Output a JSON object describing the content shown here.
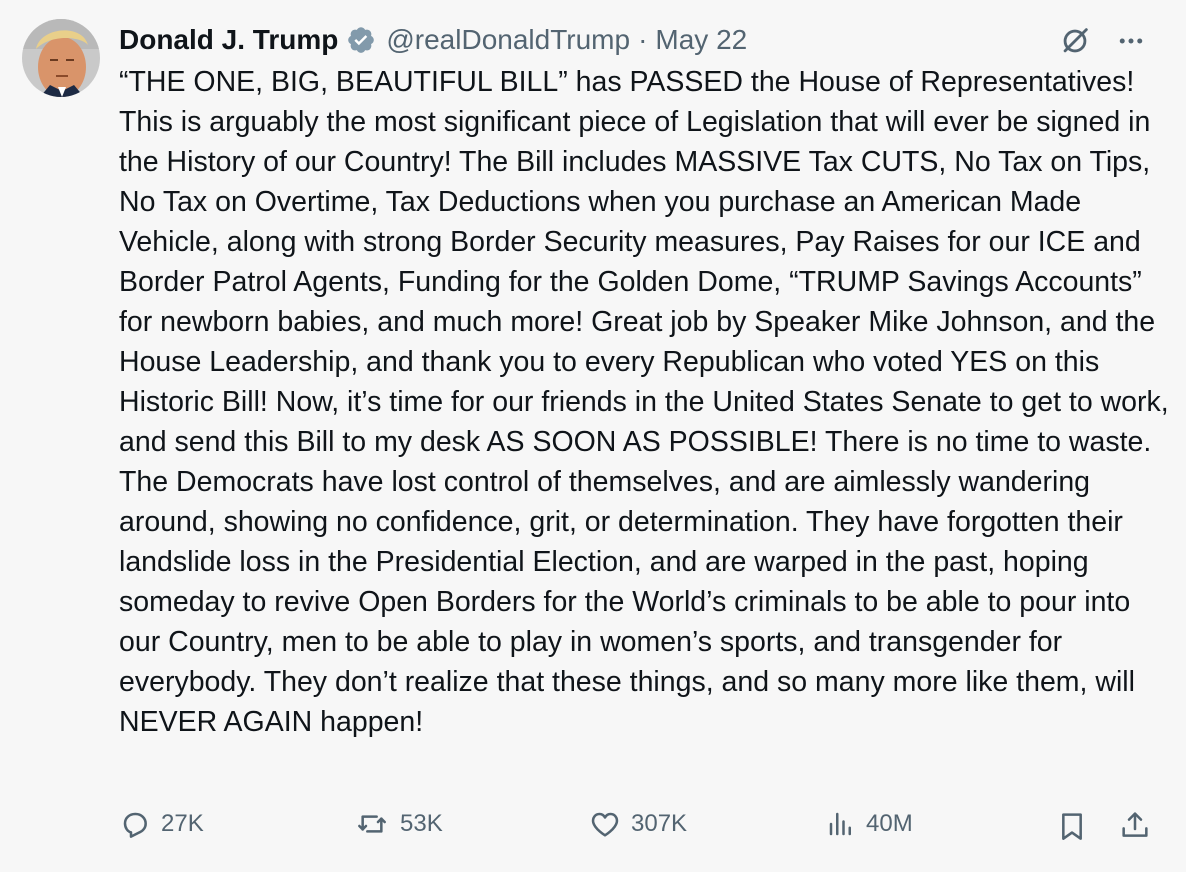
{
  "tweet": {
    "author_name": "Donald J. Trump",
    "handle": "@realDonaldTrump",
    "separator": "·",
    "date": "May 22",
    "text": "“THE ONE, BIG, BEAUTIFUL BILL” has PASSED the House of Representatives! This is arguably the most significant piece of Legislation that will ever be signed in the History of our Country! The Bill includes MASSIVE Tax CUTS, No Tax on Tips, No Tax on Overtime, Tax Deductions when you purchase an American Made Vehicle, along with strong Border Security measures, Pay Raises for our ICE and Border Patrol Agents, Funding for the Golden Dome, “TRUMP Savings Accounts” for newborn babies, and much more! Great job by Speaker Mike Johnson, and the House Leadership, and thank you to every Republican who voted YES on this Historic Bill! Now, it’s time for our friends in the United States Senate to get to work, and send this Bill to my desk AS SOON AS POSSIBLE! There is no time to waste. The Democrats have lost control of themselves, and are aimlessly wandering around, showing no confidence, grit, or determination. They have forgotten their landslide loss in the Presidential Election, and are warped in the past, hoping someday to revive Open Borders for the World’s criminals to be able to pour into our Country, men to be able to play in women’s sports, and transgender for everybody. They don’t realize that these things, and so many more like them, will NEVER AGAIN happen!"
  },
  "stats": {
    "replies": "27K",
    "reposts": "53K",
    "likes": "307K",
    "views": "40M"
  },
  "icons": {
    "verified": "verified-badge-icon",
    "grok": "grok-icon",
    "more": "more-icon",
    "reply": "reply-icon",
    "repost": "repost-icon",
    "like": "like-icon",
    "views": "views-icon",
    "bookmark": "bookmark-icon",
    "share": "share-icon"
  },
  "colors": {
    "background": "#f7f7f7",
    "text": "#0f1419",
    "secondary": "#536471",
    "verified": "#829aab"
  }
}
